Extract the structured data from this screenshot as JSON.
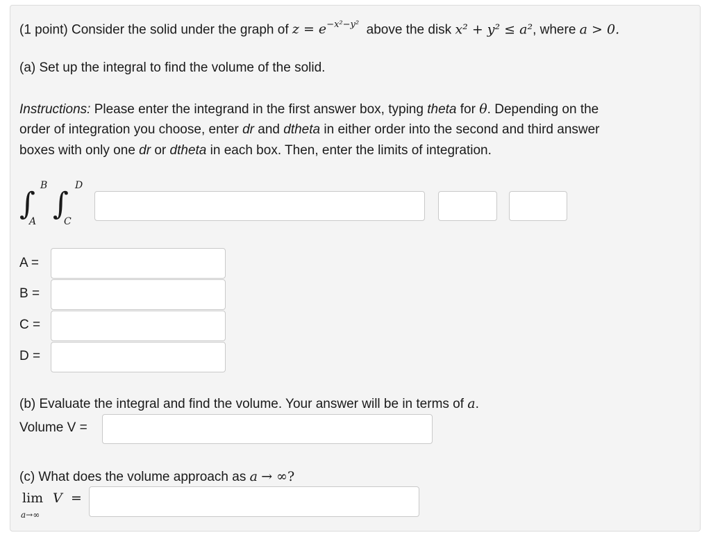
{
  "q": {
    "point": "(1 point) Consider the solid under the graph of",
    "z_eq": "z = e",
    "exp": "−x²−y²",
    "above": "above the disk",
    "disk": "x² + y² ≤ a²",
    "where": ", where",
    "cond": "a > 0."
  },
  "a": {
    "prompt": "(a) Set up the integral to find the volume of the solid.",
    "instr_label": "Instructions:",
    "instr_1": " Please enter the integrand in the first answer box, typing ",
    "theta_word": "theta",
    "instr_2": " for ",
    "theta_sym": "θ",
    "instr_3": ". Depending on the",
    "line2_a": "order of integration you choose, enter ",
    "dr": "dr",
    "line2_b": " and ",
    "dtheta": "dtheta",
    "line2_c": " in either order into the second and third answer",
    "line3_a": "boxes with only one ",
    "dr2": "dr",
    "line3_b": " or ",
    "dtheta2": "dtheta",
    "line3_c": " in each box. Then, enter the limits of integration.",
    "int_upper1": "B",
    "int_lower1": "A",
    "int_upper2": "D",
    "int_lower2": "C",
    "integral_sign": "∫",
    "labels": {
      "A": "A =",
      "B": "B =",
      "C": "C =",
      "D": "D ="
    }
  },
  "b": {
    "prompt_1": "(b) Evaluate the integral and find the volume. Your answer will be in terms of ",
    "a_var": "a",
    "prompt_2": ".",
    "vol_label": "Volume V ="
  },
  "c": {
    "prompt_1": "(c) What does the volume approach as ",
    "a_var": "a",
    "arrow": "→ ∞?",
    "lim": "lim",
    "V": "V",
    "eq": "=",
    "sub": "a→∞"
  }
}
